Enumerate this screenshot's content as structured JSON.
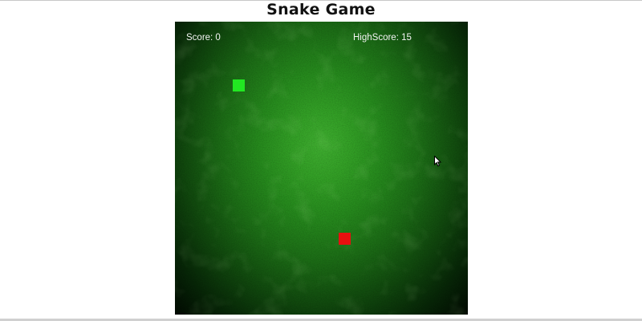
{
  "header": {
    "title": "Snake Game"
  },
  "hud": {
    "score_text": "Score: 0",
    "highscore_text": "HighScore: 15"
  },
  "colors": {
    "snake": "#22e822",
    "food": "#e80f0f",
    "board_center": "#3fae30",
    "board_edge": "#020a02",
    "hud_text": "#f4f4f4"
  },
  "icons": {
    "cursor": "mouse-pointer-icon"
  }
}
